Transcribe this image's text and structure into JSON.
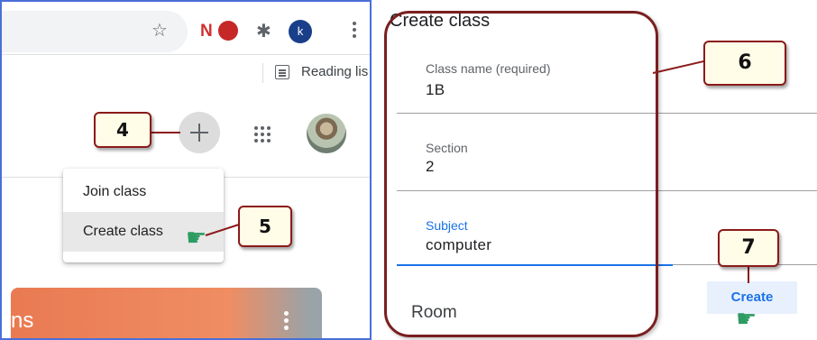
{
  "left_panel": {
    "toolbar": {
      "bookmark_star_icon": "☆",
      "ext_n_label": "N",
      "ext_red_label": "",
      "puzzle_icon": "✱",
      "profile_initial": "k",
      "reading_list_label": "Reading lis"
    },
    "classroom": {
      "callout_plus": "4",
      "callout_menu": "5",
      "menu_items": [
        "Join class",
        "Create class"
      ],
      "card_text": "ns"
    }
  },
  "right_panel": {
    "dialog_title": "Create class",
    "fields": {
      "class_name": {
        "label": "Class name (required)",
        "value": "1B"
      },
      "section": {
        "label": "Section",
        "value": "2"
      },
      "subject": {
        "label": "Subject",
        "value": "computer"
      },
      "room": {
        "label": "Room"
      }
    },
    "callout_fields": "6",
    "callout_create": "7",
    "create_button": "Create"
  },
  "colors": {
    "accent": "#1a73e8",
    "callout_border": "#8b1a1a",
    "callout_fill": "#fffde7",
    "card": "#f08d62",
    "pointer_hand": "#2e9b63"
  }
}
